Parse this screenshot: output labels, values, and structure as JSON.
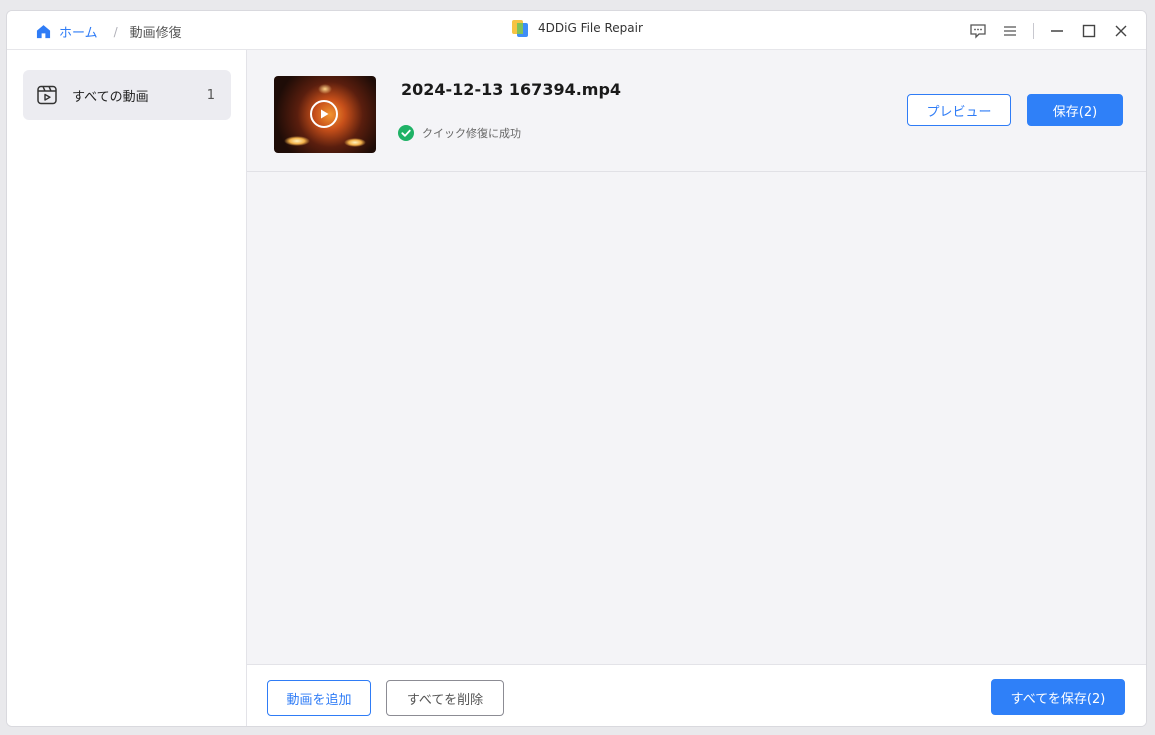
{
  "breadcrumb": {
    "home_label": "ホーム",
    "separator": "/",
    "current_label": "動画修復"
  },
  "app": {
    "title": "4DDiG File Repair"
  },
  "window_controls": [
    "feedback-icon",
    "menu-icon",
    "minimize-icon",
    "maximize-icon",
    "close-icon"
  ],
  "sidebar": {
    "items": [
      {
        "label": "すべての動画",
        "count": "1",
        "icon": "video-folder-icon"
      }
    ]
  },
  "file": {
    "name": "2024-12-13 167394.mp4",
    "status": "クイック修復に成功",
    "status_color": "#1fb266",
    "preview_label": "プレビュー",
    "save_label": "保存(2)"
  },
  "footer": {
    "add_label": "動画を追加",
    "delete_label": "すべてを削除",
    "save_all_label": "すべてを保存(2)"
  },
  "colors": {
    "accent": "#2f80f8",
    "success": "#1fb266"
  }
}
